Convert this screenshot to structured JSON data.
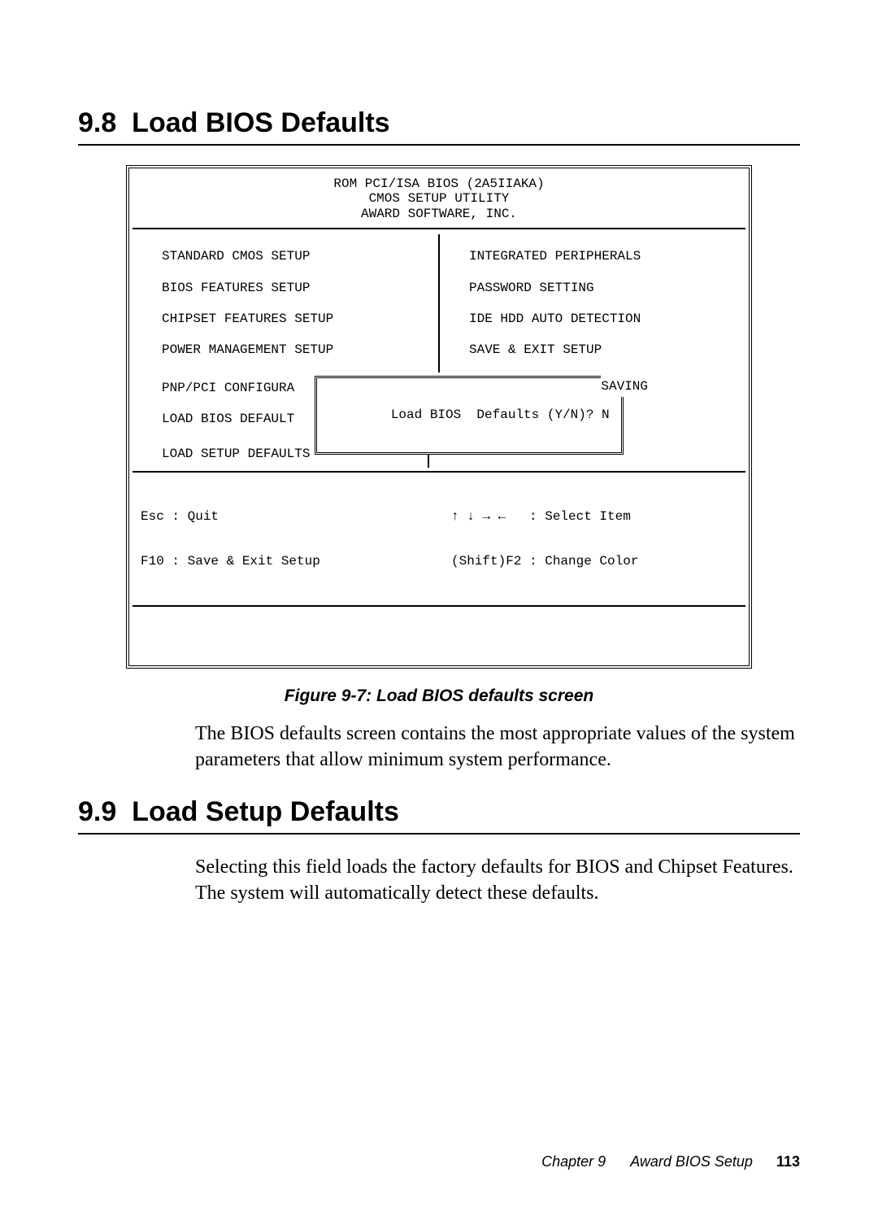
{
  "section98": {
    "number": "9.8",
    "title": "Load BIOS Defaults"
  },
  "bios": {
    "header1": "ROM PCI/ISA BIOS (2A5IIAKA)",
    "header2": "CMOS SETUP UTILITY",
    "header3": "AWARD SOFTWARE, INC.",
    "left_menu": [
      "STANDARD CMOS SETUP",
      "BIOS FEATURES SETUP",
      "CHIPSET FEATURES SETUP",
      "POWER MANAGEMENT SETUP"
    ],
    "right_menu": [
      "INTEGRATED PERIPHERALS",
      "PASSWORD SETTING",
      "IDE HDD AUTO DETECTION",
      "SAVE & EXIT SETUP"
    ],
    "left_trunc1": "PNP/PCI CONFIGURA",
    "left_trunc2": "LOAD BIOS DEFAULT",
    "saving": "SAVING",
    "dialog": "Load BIOS  Defaults (Y/N)? N",
    "bottom_left": "LOAD SETUP DEFAULTS",
    "footer_left1": "Esc : Quit",
    "footer_left2": "F10 : Save & Exit Setup",
    "footer_right1": "↑ ↓ → ←   : Select Item",
    "footer_right2": "(Shift)F2 : Change Color"
  },
  "fig_caption": "Figure 9-7: Load BIOS defaults screen",
  "para98": "The BIOS defaults screen contains the most appropriate values of the system parameters that allow minimum system performance.",
  "section99": {
    "number": "9.9",
    "title": "Load Setup Defaults"
  },
  "para99": "Selecting this field loads the factory defaults for BIOS and Chipset Features. The system will automatically detect these defaults.",
  "footer": {
    "chapter": "Chapter 9",
    "title": "Award BIOS Setup",
    "page": "113"
  }
}
